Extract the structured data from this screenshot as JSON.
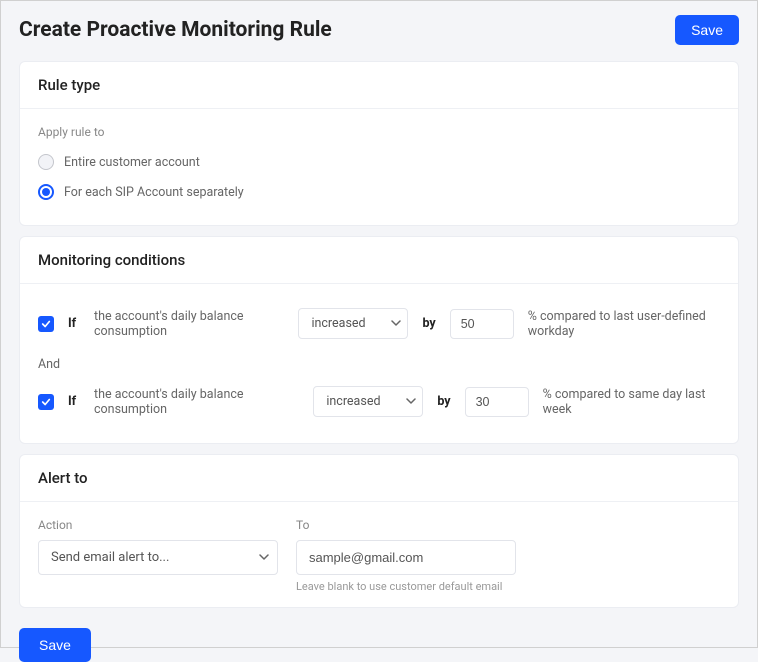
{
  "header": {
    "title": "Create Proactive Monitoring Rule",
    "save_label": "Save"
  },
  "rule_type": {
    "section_title": "Rule type",
    "apply_label": "Apply rule to",
    "options": [
      {
        "label": "Entire customer account",
        "selected": false
      },
      {
        "label": "For each SIP Account separately",
        "selected": true
      }
    ]
  },
  "monitoring": {
    "section_title": "Monitoring conditions",
    "if_label": "If",
    "by_label": "by",
    "and_label": "And",
    "conditions": [
      {
        "checked": true,
        "text": "the account's daily balance consumption",
        "direction_value": "increased",
        "amount_value": "50",
        "suffix": "% compared to last user-defined workday"
      },
      {
        "checked": true,
        "text": "the account's daily balance consumption",
        "direction_value": "increased",
        "amount_value": "30",
        "suffix": "% compared to same day last week"
      }
    ]
  },
  "alert": {
    "section_title": "Alert to",
    "action_label": "Action",
    "action_value": "Send email alert to...",
    "to_label": "To",
    "to_value": "sample@gmail.com",
    "hint": "Leave blank to use customer default email"
  },
  "footer": {
    "save_label": "Save"
  }
}
